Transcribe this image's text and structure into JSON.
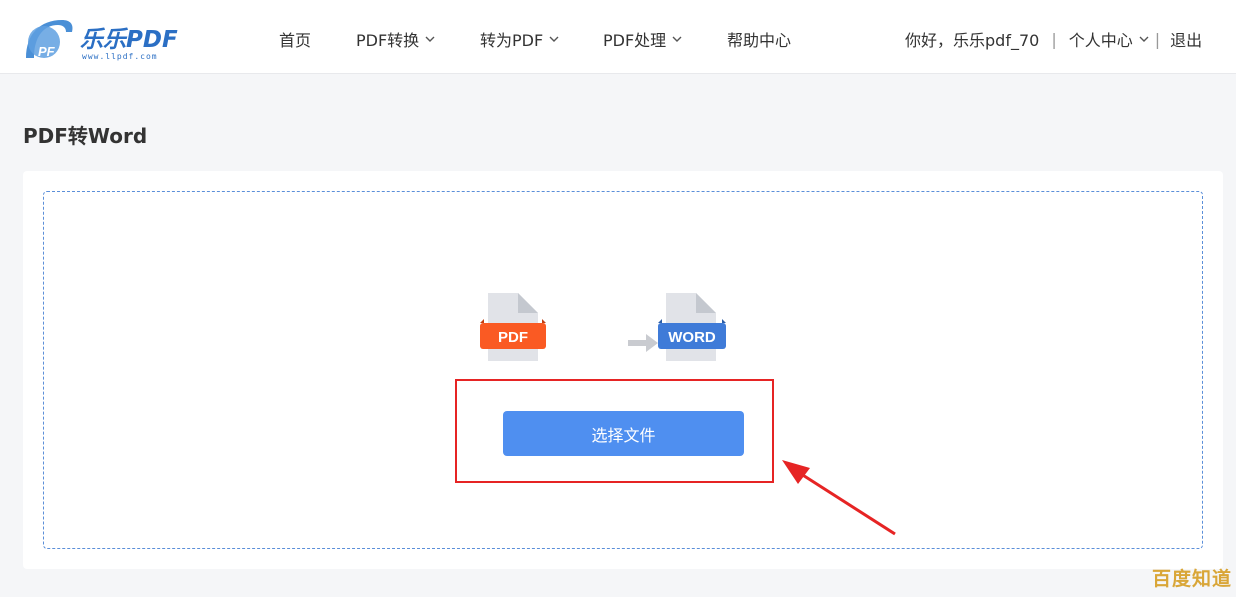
{
  "header": {
    "logo_text": "乐乐PDF",
    "logo_url_text": "www.llpdf.com",
    "nav": [
      {
        "label": "首页",
        "has_dropdown": false
      },
      {
        "label": "PDF转换",
        "has_dropdown": true
      },
      {
        "label": "转为PDF",
        "has_dropdown": true
      },
      {
        "label": "PDF处理",
        "has_dropdown": true
      },
      {
        "label": "帮助中心",
        "has_dropdown": false
      }
    ],
    "user_greeting": "你好，乐乐pdf_70",
    "personal_center": "个人中心",
    "logout": "退出"
  },
  "main": {
    "title": "PDF转Word",
    "from_format": "PDF",
    "to_format": "WORD",
    "select_button": "选择文件"
  },
  "watermark": "百度知道",
  "colors": {
    "primary": "#4f8ff0",
    "pdf": "#fa5a23",
    "word": "#3f7bd8",
    "annotation": "#e62424"
  }
}
